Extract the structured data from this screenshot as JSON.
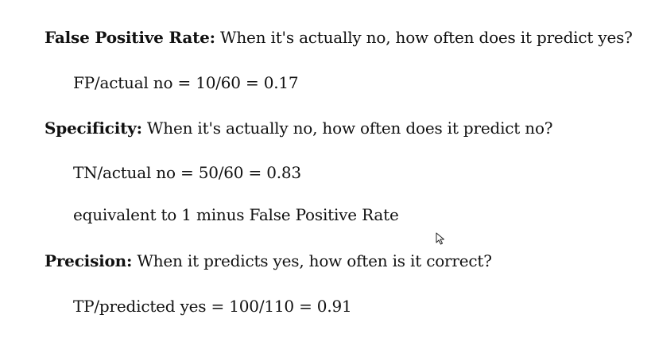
{
  "sections": [
    {
      "term": "False Positive Rate:",
      "question": " When it's actually no, how often does it predict yes?",
      "details": [
        "FP/actual no = 10/60 = 0.17"
      ]
    },
    {
      "term": "Specificity:",
      "question": " When it's actually no, how often does it predict no?",
      "details": [
        "TN/actual no = 50/60 = 0.83",
        "equivalent to 1 minus False Positive Rate"
      ]
    },
    {
      "term": "Precision:",
      "question": " When it predicts yes, how often is it correct?",
      "details": [
        "TP/predicted yes = 100/110 = 0.91"
      ]
    }
  ],
  "cursor_icon": "mouse-pointer-icon"
}
